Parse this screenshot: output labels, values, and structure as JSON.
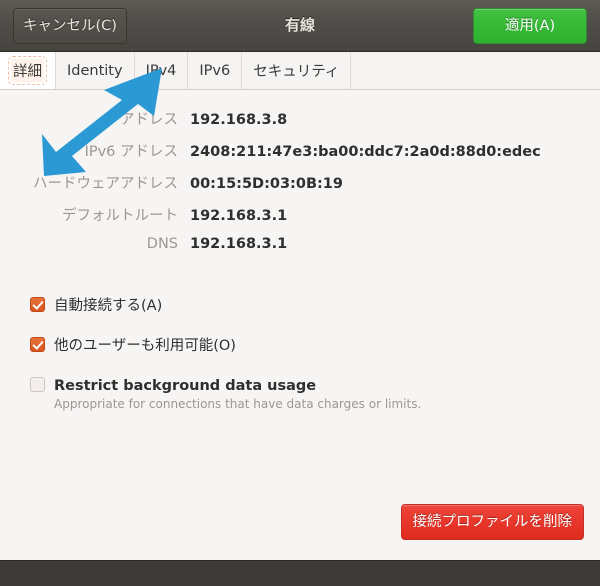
{
  "header": {
    "title": "有線",
    "cancel_label": "キャンセル(C)",
    "apply_label": "適用(A)"
  },
  "tabs": [
    {
      "label": "詳細",
      "active": true
    },
    {
      "label": "Identity",
      "active": false
    },
    {
      "label": "IPv4",
      "active": false
    },
    {
      "label": "IPv6",
      "active": false
    },
    {
      "label": "セキュリティ",
      "active": false
    }
  ],
  "details": {
    "rows": [
      {
        "label": "アドレス",
        "value": "192.168.3.8"
      },
      {
        "label": "IPv6 アドレス",
        "value": "2408:211:47e3:ba00:ddc7:2a0d:88d0:edec"
      },
      {
        "label": "ハードウェアアドレス",
        "value": "00:15:5D:03:0B:19"
      },
      {
        "label": "デフォルトルート",
        "value": "192.168.3.1"
      },
      {
        "label": "DNS",
        "value": "192.168.3.1"
      }
    ]
  },
  "options": [
    {
      "label": "自動接続する(A)",
      "checked": true,
      "sub": ""
    },
    {
      "label": "他のユーザーも利用可能(O)",
      "checked": true,
      "sub": ""
    },
    {
      "label": "Restrict background data usage",
      "checked": false,
      "sub": "Appropriate for connections that have data charges or limits."
    }
  ],
  "footer": {
    "delete_label": "接続プロファイルを削除"
  },
  "annotation": {
    "icon": "arrow-up-right-icon",
    "color": "#2b9ad4",
    "points_to": "IPv4"
  },
  "colors": {
    "accent_green": "#32b432",
    "accent_red": "#e0291d",
    "accent_orange": "#d9551e",
    "header_dark": "#504e49",
    "content_bg": "#f7f4f4"
  }
}
